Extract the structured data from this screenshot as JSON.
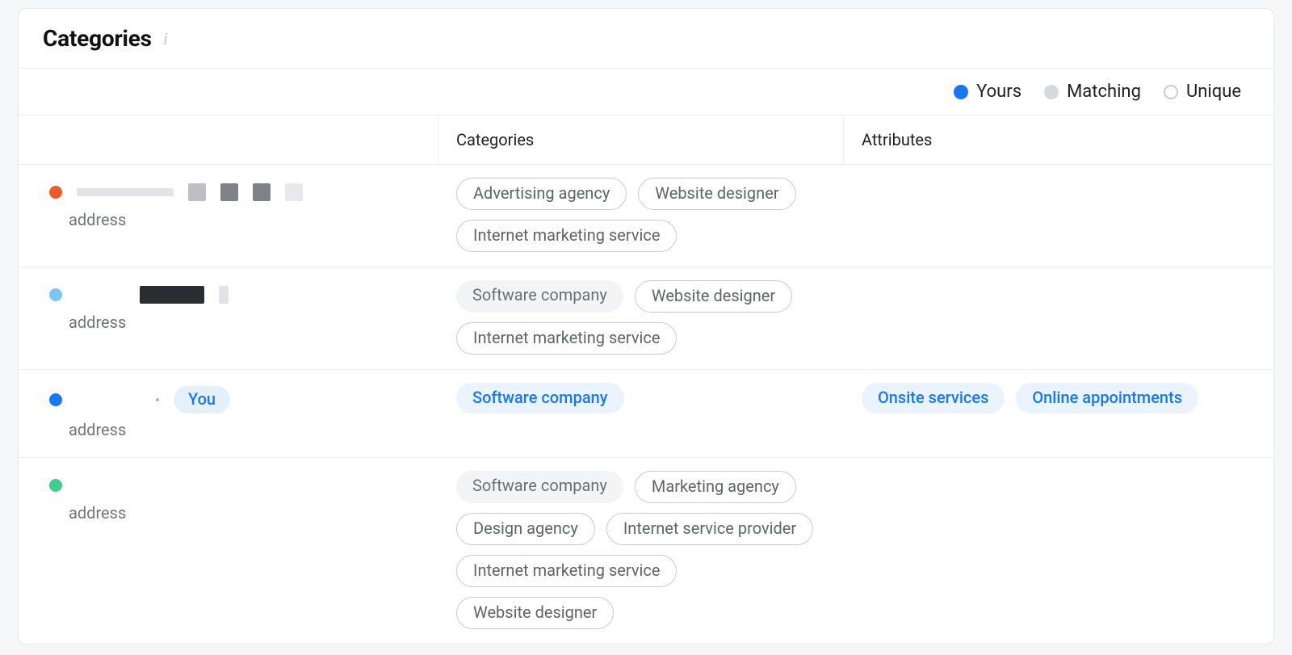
{
  "header": {
    "title": "Categories"
  },
  "legend": {
    "yours": "Yours",
    "matching": "Matching",
    "unique": "Unique"
  },
  "columns": {
    "categories": "Categories",
    "attributes": "Attributes"
  },
  "rows": [
    {
      "address": "address",
      "categories": [
        {
          "label": "Advertising agency",
          "style": "outline"
        },
        {
          "label": "Website designer",
          "style": "outline"
        },
        {
          "label": "Internet marketing service",
          "style": "outline"
        }
      ],
      "attributes": []
    },
    {
      "address": "address",
      "categories": [
        {
          "label": "Software company",
          "style": "soft"
        },
        {
          "label": "Website designer",
          "style": "outline"
        },
        {
          "label": "Internet marketing service",
          "style": "outline"
        }
      ],
      "attributes": []
    },
    {
      "you_label": "You",
      "address": "address",
      "categories": [
        {
          "label": "Software company",
          "style": "blue"
        }
      ],
      "attributes": [
        {
          "label": "Onsite services",
          "style": "blue"
        },
        {
          "label": "Online appointments",
          "style": "blue"
        }
      ]
    },
    {
      "address": "address",
      "categories": [
        {
          "label": "Software company",
          "style": "soft"
        },
        {
          "label": "Marketing agency",
          "style": "outline"
        },
        {
          "label": "Design agency",
          "style": "outline"
        },
        {
          "label": "Internet service provider",
          "style": "outline"
        },
        {
          "label": "Internet marketing service",
          "style": "outline"
        },
        {
          "label": "Website designer",
          "style": "outline"
        }
      ],
      "attributes": []
    }
  ]
}
